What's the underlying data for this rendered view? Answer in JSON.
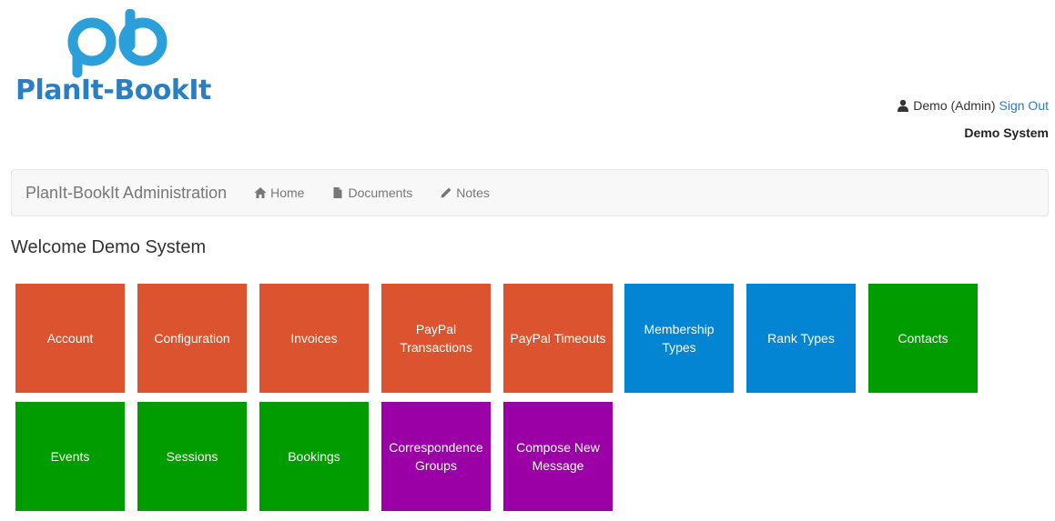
{
  "logo": {
    "text": "PlanIt-BookIt"
  },
  "user": {
    "name": "Demo (Admin)",
    "sign_out": "Sign Out",
    "organization": "Demo System"
  },
  "navbar": {
    "brand": "PlanIt-BookIt Administration",
    "links": [
      {
        "label": "Home",
        "icon": "home-icon"
      },
      {
        "label": "Documents",
        "icon": "document-icon"
      },
      {
        "label": "Notes",
        "icon": "pencil-icon"
      }
    ]
  },
  "welcome": "Welcome Demo System",
  "colors": {
    "orange": "#dc532f",
    "blue": "#0385d3",
    "green": "#009c00",
    "purple": "#9a00a5",
    "logo_blue": "#2a7fc4"
  },
  "tiles": [
    {
      "label": "Account",
      "color": "orange"
    },
    {
      "label": "Configuration",
      "color": "orange"
    },
    {
      "label": "Invoices",
      "color": "orange"
    },
    {
      "label": "PayPal Transactions",
      "color": "orange"
    },
    {
      "label": "PayPal Timeouts",
      "color": "orange"
    },
    {
      "label": "Membership Types",
      "color": "blue"
    },
    {
      "label": "Rank Types",
      "color": "blue"
    },
    {
      "label": "Contacts",
      "color": "green"
    },
    {
      "label": "Events",
      "color": "green"
    },
    {
      "label": "Sessions",
      "color": "green"
    },
    {
      "label": "Bookings",
      "color": "green"
    },
    {
      "label": "Correspondence Groups",
      "color": "purple"
    },
    {
      "label": "Compose New Message",
      "color": "purple"
    }
  ]
}
